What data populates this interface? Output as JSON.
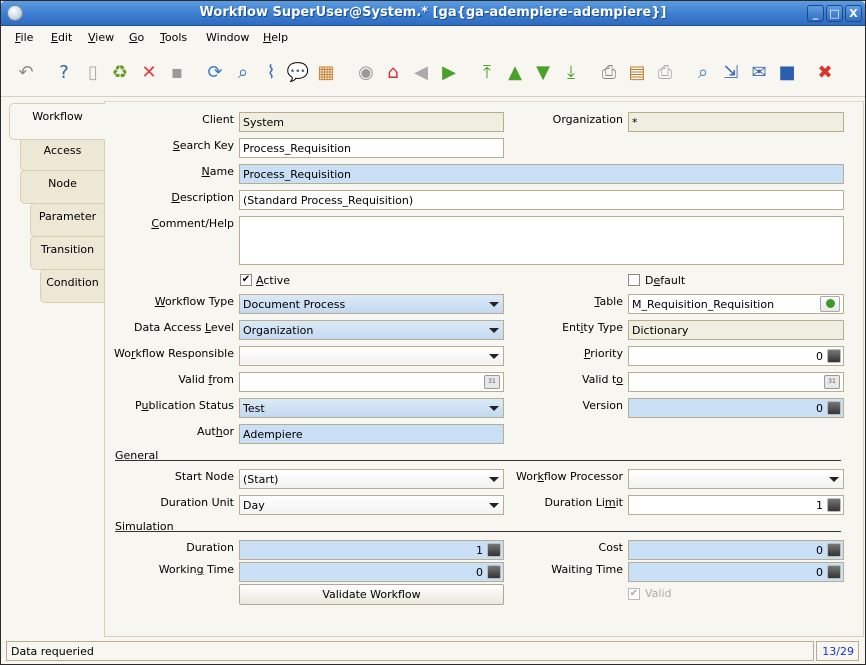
{
  "window": {
    "title": "Workflow  SuperUser@System.* [ga{ga-adempiere-adempiere}]",
    "controls": {
      "minimize": "_",
      "maximize": "□",
      "close": "X"
    }
  },
  "menu": [
    {
      "label": "File",
      "mnemonic": "F"
    },
    {
      "label": "Edit",
      "mnemonic": "E"
    },
    {
      "label": "View",
      "mnemonic": "V"
    },
    {
      "label": "Go",
      "mnemonic": "G"
    },
    {
      "label": "Tools",
      "mnemonic": "T"
    },
    {
      "label": "Window",
      "mnemonic": ""
    },
    {
      "label": "Help",
      "mnemonic": "H"
    }
  ],
  "toolbar": [
    {
      "name": "undo-icon",
      "glyph": "↶",
      "color": "#8a8a8a"
    },
    {
      "name": "help-icon",
      "glyph": "?",
      "color": "#2d5fa8"
    },
    {
      "name": "new-record-icon",
      "glyph": "▯",
      "color": "#aaaaaa"
    },
    {
      "name": "copy-record-icon",
      "glyph": "♻",
      "color": "#6b9a2a"
    },
    {
      "name": "delete-icon",
      "glyph": "✕",
      "color": "#e03a3a"
    },
    {
      "name": "save-icon",
      "glyph": "▪",
      "color": "#9a9a9a"
    },
    {
      "name": "refresh-icon",
      "glyph": "⟳",
      "color": "#3a7ac0"
    },
    {
      "name": "find-icon",
      "glyph": "⌕",
      "color": "#3a6ab0"
    },
    {
      "name": "attachment-icon",
      "glyph": "⌇",
      "color": "#3a6ab0"
    },
    {
      "name": "chat-icon",
      "glyph": "💬",
      "color": "#888888"
    },
    {
      "name": "grid-toggle-icon",
      "glyph": "▦",
      "color": "#d08030"
    },
    {
      "name": "history-icon",
      "glyph": "◉",
      "color": "#999999"
    },
    {
      "name": "home-icon",
      "glyph": "⌂",
      "color": "#d03030"
    },
    {
      "name": "parent-record-icon",
      "glyph": "◀",
      "color": "#aaaaaa"
    },
    {
      "name": "detail-record-icon",
      "glyph": "▶",
      "color": "#4aa02a"
    },
    {
      "name": "first-record-icon",
      "glyph": "⤒",
      "color": "#4aa02a"
    },
    {
      "name": "previous-record-icon",
      "glyph": "▲",
      "color": "#4aa02a"
    },
    {
      "name": "next-record-icon",
      "glyph": "▼",
      "color": "#4aa02a"
    },
    {
      "name": "last-record-icon",
      "glyph": "⤓",
      "color": "#4aa02a"
    },
    {
      "name": "report-icon",
      "glyph": "⎙",
      "color": "#888888"
    },
    {
      "name": "archive-icon",
      "glyph": "▤",
      "color": "#c08030"
    },
    {
      "name": "print-icon",
      "glyph": "⎙",
      "color": "#aaaaaa"
    },
    {
      "name": "zoom-across-icon",
      "glyph": "⌕",
      "color": "#4a7ab0"
    },
    {
      "name": "active-workflows-icon",
      "glyph": "⇲",
      "color": "#3a6ab0"
    },
    {
      "name": "request-icon",
      "glyph": "✉",
      "color": "#3a6ab0"
    },
    {
      "name": "product-info-icon",
      "glyph": "■",
      "color": "#2a5fb0"
    },
    {
      "name": "exit-icon",
      "glyph": "✖",
      "color": "#e03030"
    }
  ],
  "tabs": [
    {
      "label": "Workflow",
      "active": true
    },
    {
      "label": "Access",
      "active": false
    },
    {
      "label": "Node",
      "active": false
    },
    {
      "label": "Parameter",
      "active": false
    },
    {
      "label": "Transition",
      "active": false
    },
    {
      "label": "Condition",
      "active": false
    }
  ],
  "form": {
    "client": {
      "label": "Client",
      "value": "System"
    },
    "organization": {
      "label": "Organization",
      "value": "*"
    },
    "search_key": {
      "label": "Search Key",
      "value": "Process_Requisition"
    },
    "name": {
      "label": "Name",
      "value": "Process_Requisition"
    },
    "description": {
      "label": "Description",
      "value": "(Standard Process_Requisition)"
    },
    "comment_help": {
      "label": "Comment/Help",
      "value": ""
    },
    "active": {
      "label": "Active",
      "checked": true
    },
    "default": {
      "label": "Default",
      "checked": false
    },
    "workflow_type": {
      "label": "Workflow Type",
      "value": "Document Process"
    },
    "table": {
      "label": "Table",
      "value": "M_Requisition_Requisition"
    },
    "data_access_level": {
      "label": "Data Access Level",
      "value": "Organization"
    },
    "entity_type": {
      "label": "Entity Type",
      "value": "Dictionary"
    },
    "workflow_responsible": {
      "label": "Workflow Responsible",
      "value": ""
    },
    "priority": {
      "label": "Priority",
      "value": "0"
    },
    "valid_from": {
      "label": "Valid from",
      "value": ""
    },
    "valid_to": {
      "label": "Valid to",
      "value": ""
    },
    "publication_status": {
      "label": "Publication Status",
      "value": "Test"
    },
    "version": {
      "label": "Version",
      "value": "0"
    },
    "author": {
      "label": "Author",
      "value": "Adempiere"
    },
    "general_section": "General",
    "start_node": {
      "label": "Start Node",
      "value": "(Start)"
    },
    "workflow_processor": {
      "label": "Workflow Processor",
      "value": ""
    },
    "duration_unit": {
      "label": "Duration Unit",
      "value": "Day"
    },
    "duration_limit": {
      "label": "Duration Limit",
      "value": "1"
    },
    "simulation_section": "Simulation",
    "duration": {
      "label": "Duration",
      "value": "1"
    },
    "cost": {
      "label": "Cost",
      "value": "0"
    },
    "working_time": {
      "label": "Working Time",
      "value": "0"
    },
    "waiting_time": {
      "label": "Waiting Time",
      "value": "0"
    },
    "validate_button": "Validate Workflow",
    "valid": {
      "label": "Valid",
      "checked": true
    }
  },
  "status": {
    "message": "Data requeried",
    "record_count": "13/29"
  }
}
